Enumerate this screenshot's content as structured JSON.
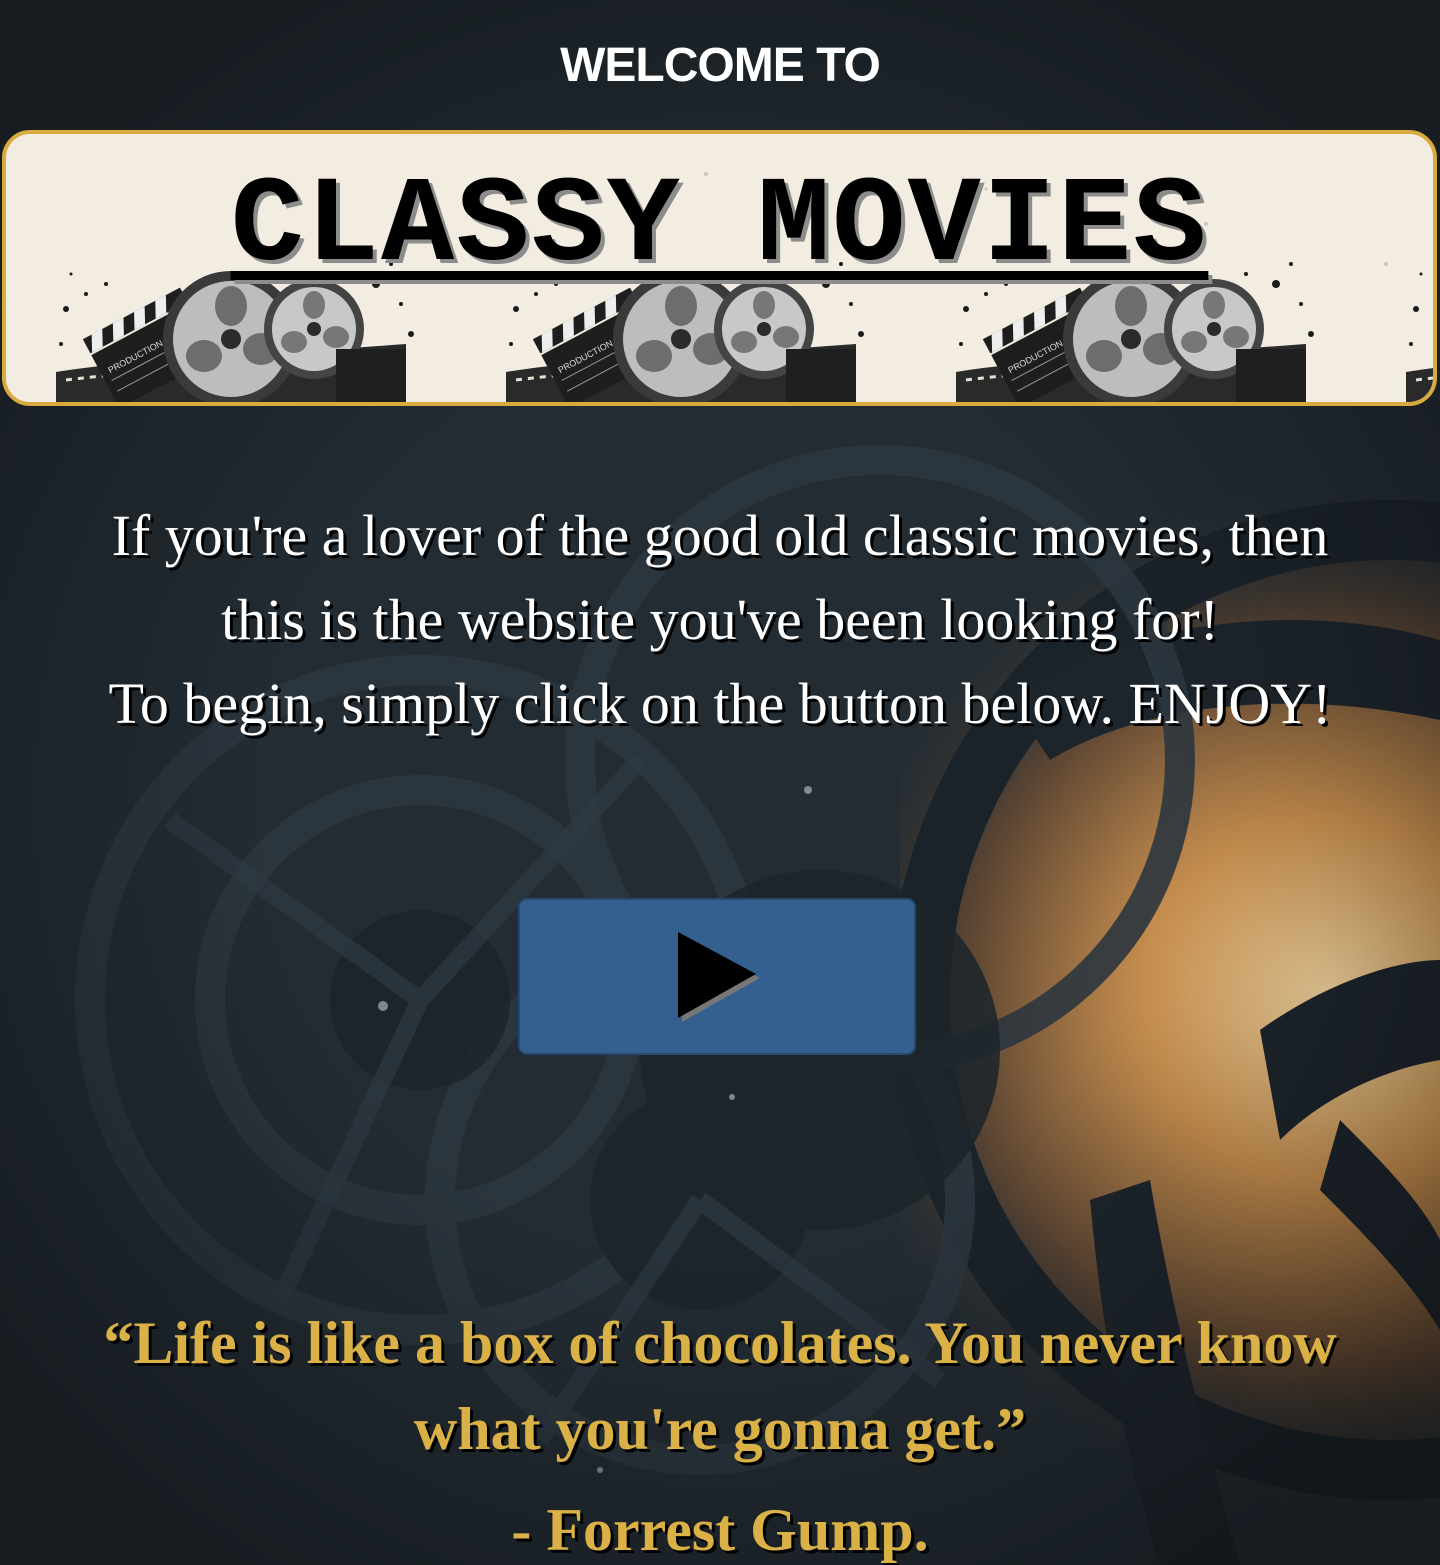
{
  "header": {
    "welcome": "WELCOME TO"
  },
  "banner": {
    "title": "CLASSY MOVIES",
    "clapper_text": "PRODUCTION"
  },
  "intro": {
    "line1": "If you're a lover of the good old classic movies, then",
    "line2": "this is the website you've been looking for!",
    "line3": "To begin, simply click on the button below. ENJOY!"
  },
  "play_button": {
    "icon": "play-icon"
  },
  "quote": {
    "text": "“Life is like a box of chocolates. You never know what you're gonna get.”",
    "author": "- Forrest Gump."
  },
  "colors": {
    "background": "#222b31",
    "banner_border": "#d9aa3e",
    "banner_bg": "#f2ece1",
    "button": "#34608f",
    "quote": "#d9b146"
  }
}
